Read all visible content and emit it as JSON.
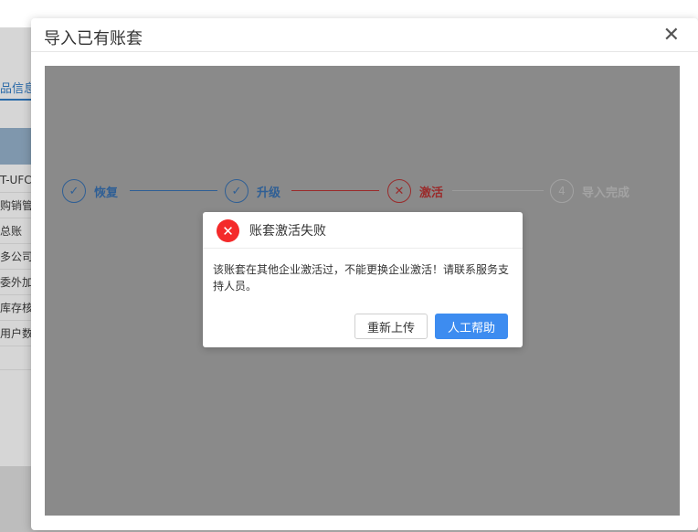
{
  "background": {
    "tab_label": "品信息",
    "rows": [
      "T-UFC",
      "购销管",
      "总账",
      "多公司",
      "委外加",
      "库存核",
      "用户数"
    ]
  },
  "modal": {
    "title": "导入已有账套",
    "close_glyph": "✕"
  },
  "steps": [
    {
      "label": "恢复",
      "status": "done",
      "glyph": "✓"
    },
    {
      "label": "升级",
      "status": "done",
      "glyph": "✓"
    },
    {
      "label": "激活",
      "status": "error",
      "glyph": "✕"
    },
    {
      "label": "导入完成",
      "status": "wait",
      "glyph": "4"
    }
  ],
  "alert": {
    "icon": "error-circle-icon",
    "icon_glyph": "✕",
    "title": "账套激活失败",
    "message": "该账套在其他企业激活过，不能更换企业激活！请联系服务支持人员。",
    "buttons": {
      "reupload": "重新上传",
      "help": "人工帮助"
    }
  },
  "colors": {
    "primary": "#3d8cf0",
    "error": "#f42a2a",
    "step_done": "#2f5f95",
    "step_error": "#9a2b2b",
    "overlay": "#8a8a8a"
  }
}
